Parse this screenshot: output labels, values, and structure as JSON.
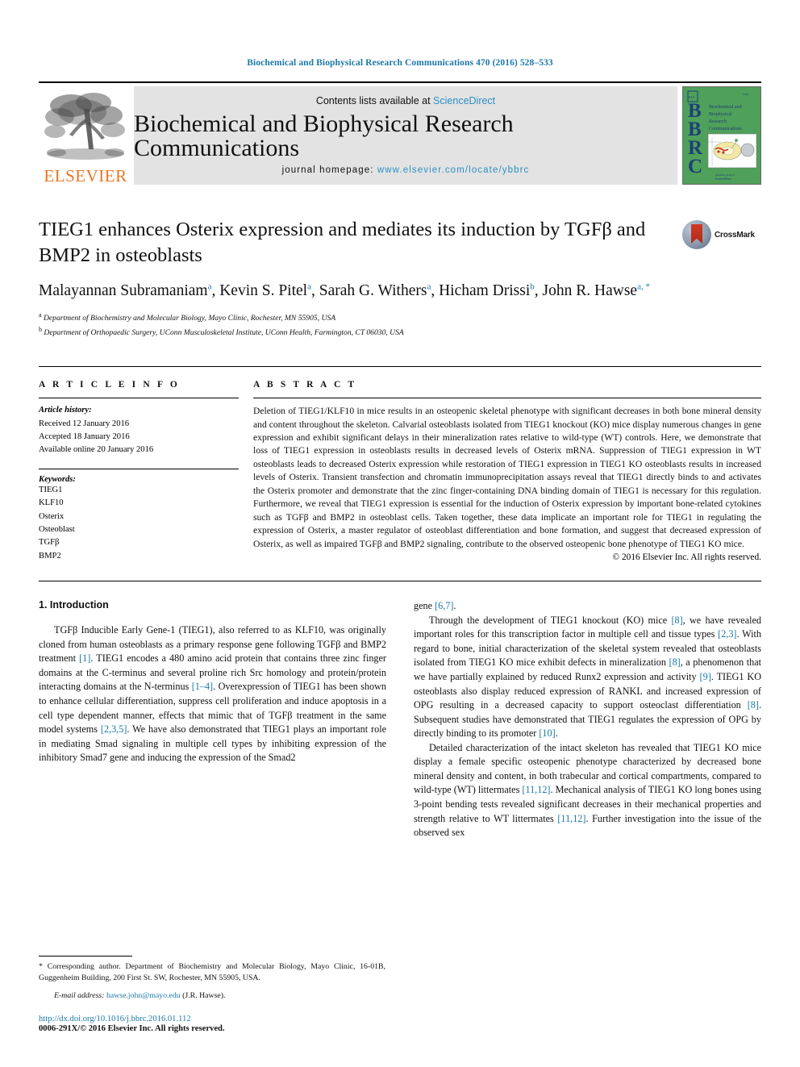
{
  "running_head": "Biochemical and Biophysical Research Communications 470 (2016) 528–533",
  "masthead": {
    "publisher_name": "ELSEVIER",
    "contents_prefix": "Contents lists available at",
    "contents_link": "ScienceDirect",
    "journal_title": "Biochemical and Biophysical Research Communications",
    "homepage_prefix": "journal homepage:",
    "homepage_link": "www.elsevier.com/locate/ybbrc",
    "cover": {
      "letters": "BBRC",
      "title_lines": [
        "Biochemical and",
        "Biophysical",
        "Research",
        "Communications"
      ],
      "background_color": "#4fa05a",
      "letter_color": "#1f3f78"
    }
  },
  "article": {
    "title": "TIEG1 enhances Osterix expression and mediates its induction by TGFβ and BMP2 in osteoblasts",
    "crossmark_label": "CrossMark",
    "authors": "Malayannan Subramaniam <a>, Kevin S. Pitel <a>, Sarah G. Withers <a>, Hicham Drissi <b>, John R. Hawse <a, *>",
    "authors_parts": [
      {
        "name": "Malayannan Subramaniam",
        "sup": "a",
        "sep": ", "
      },
      {
        "name": "Kevin S. Pitel",
        "sup": "a",
        "sep": ", "
      },
      {
        "name": "Sarah G. Withers",
        "sup": "a",
        "sep": ", "
      },
      {
        "name": "Hicham Drissi",
        "sup": "b",
        "sep": ", "
      },
      {
        "name": "John R. Hawse",
        "sup": "a, *",
        "sep": ""
      }
    ],
    "affiliations": [
      {
        "marker": "a",
        "text": "Department of Biochemistry and Molecular Biology, Mayo Clinic, Rochester, MN 55905, USA"
      },
      {
        "marker": "b",
        "text": "Department of Orthopaedic Surgery, UConn Musculoskeletal Institute, UConn Health, Farmington, CT 06030, USA"
      }
    ]
  },
  "info": {
    "heading": "A R T I C L E   I N F O",
    "history_label": "Article history:",
    "history": [
      "Received 12 January 2016",
      "Accepted 18 January 2016",
      "Available online 20 January 2016"
    ],
    "keywords_label": "Keywords:",
    "keywords": [
      "TIEG1",
      "KLF10",
      "Osterix",
      "Osteoblast",
      "TGFβ",
      "BMP2"
    ]
  },
  "abstract": {
    "heading": "A B S T R A C T",
    "text": "Deletion of TIEG1/KLF10 in mice results in an osteopenic skeletal phenotype with significant decreases in both bone mineral density and content throughout the skeleton. Calvarial osteoblasts isolated from TIEG1 knockout (KO) mice display numerous changes in gene expression and exhibit significant delays in their mineralization rates relative to wild-type (WT) controls. Here, we demonstrate that loss of TIEG1 expression in osteoblasts results in decreased levels of Osterix mRNA. Suppression of TIEG1 expression in WT osteoblasts leads to decreased Osterix expression while restoration of TIEG1 expression in TIEG1 KO osteoblasts results in increased levels of Osterix. Transient transfection and chromatin immunoprecipitation assays reveal that TIEG1 directly binds to and activates the Osterix promoter and demonstrate that the zinc finger-containing DNA binding domain of TIEG1 is necessary for this regulation. Furthermore, we reveal that TIEG1 expression is essential for the induction of Osterix expression by important bone-related cytokines such as TGFβ and BMP2 in osteoblast cells. Taken together, these data implicate an important role for TIEG1 in regulating the expression of Osterix, a master regulator of osteoblast differentiation and bone formation, and suggest that decreased expression of Osterix, as well as impaired TGFβ and BMP2 signaling, contribute to the observed osteopenic bone phenotype of TIEG1 KO mice.",
    "copyright": "© 2016 Elsevier Inc. All rights reserved."
  },
  "body": {
    "section_heading": "1. Introduction",
    "left_paragraph": "TGFβ Inducible Early Gene-1 (TIEG1), also referred to as KLF10, was originally cloned from human osteoblasts as a primary response gene following TGFβ and BMP2 treatment [1]. TIEG1 encodes a 480 amino acid protein that contains three zinc finger domains at the C-terminus and several proline rich Src homology and protein/protein interacting domains at the N-terminus [1–4]. Overexpression of TIEG1 has been shown to enhance cellular differentiation, suppress cell proliferation and induce apoptosis in a cell type dependent manner, effects that mimic that of TGFβ treatment in the same model systems [2,3,5]. We have also demonstrated that TIEG1 plays an important role in mediating Smad signaling in multiple cell types by inhibiting expression of the inhibitory Smad7 gene and inducing the expression of the Smad2",
    "right_continuation": "gene [6,7].",
    "right_paragraph_1": "Through the development of TIEG1 knockout (KO) mice [8], we have revealed important roles for this transcription factor in multiple cell and tissue types [2,3]. With regard to bone, initial characterization of the skeletal system revealed that osteoblasts isolated from TIEG1 KO mice exhibit defects in mineralization [8], a phenomenon that we have partially explained by reduced Runx2 expression and activity [9]. TIEG1 KO osteoblasts also display reduced expression of RANKL and increased expression of OPG resulting in a decreased capacity to support osteoclast differentiation [8]. Subsequent studies have demonstrated that TIEG1 regulates the expression of OPG by directly binding to its promoter [10].",
    "right_paragraph_2": "Detailed characterization of the intact skeleton has revealed that TIEG1 KO mice display a female specific osteopenic phenotype characterized by decreased bone mineral density and content, in both trabecular and cortical compartments, compared to wild-type (WT) littermates [11,12]. Mechanical analysis of TIEG1 KO long bones using 3-point bending tests revealed significant decreases in their mechanical properties and strength relative to WT littermates [11,12]. Further investigation into the issue of the observed sex"
  },
  "footnotes": {
    "corresponding": "* Corresponding author. Department of Biochemistry and Molecular Biology, Mayo Clinic, 16-01B, Guggenheim Building, 200 First St. SW, Rochester, MN 55905, USA.",
    "email_label": "E-mail address:",
    "email": "hawse.john@mayo.edu",
    "email_suffix": "(J.R. Hawse).",
    "doi": "http://dx.doi.org/10.1016/j.bbrc.2016.01.112",
    "issn": "0006-291X/© 2016 Elsevier Inc. All rights reserved."
  },
  "colors": {
    "link_blue": "#1b78a8",
    "sciencedirect_blue": "#2b8fc4",
    "elsevier_orange": "#E87722",
    "cover_green": "#4fa05a"
  }
}
